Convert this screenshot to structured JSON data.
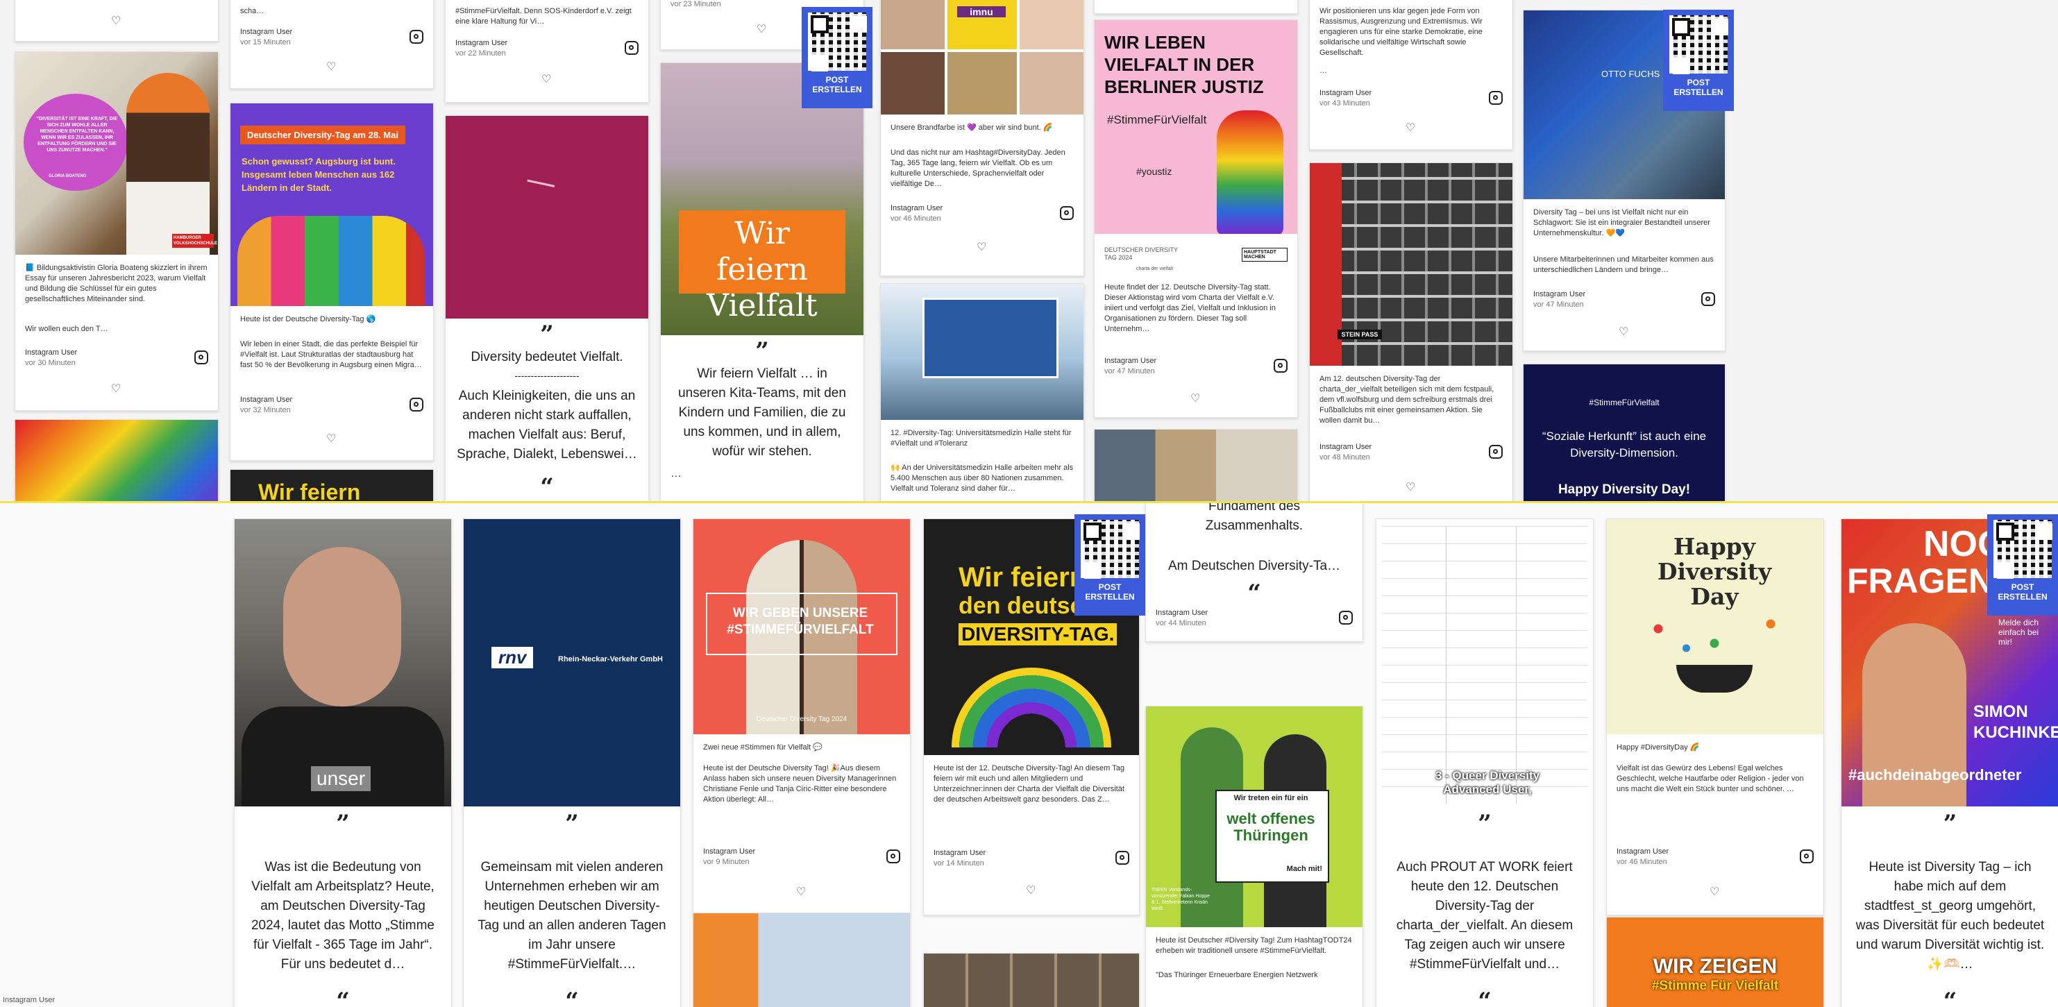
{
  "post_button": {
    "line1": "POST",
    "line2": "ERSTELLEN"
  },
  "quote_mark": "”",
  "quote_open": "“",
  "heart_glyph": "♡",
  "top": {
    "c1": {
      "gloria_quote": "\"DIVERSITÄT IST EINE KRAFT, DIE SICH ZUM WOHLE ALLER MENSCHEN ENTFALTEN KANN, WENN WIR ES ZULASSEN, IHR ENTFALTUNG FÖRDERN UND SIE UNS ZUNUTZE MACHEN.\"",
      "gloria_name": "GLORIA BOATENG",
      "gloria_badge": "HAMBURGER VOLKSHOCHSCHULE",
      "gloria_text": "📘 Bildungsaktivistin Gloria Boateng skizziert in ihrem Essay für unseren Jahresbericht 2023, warum Vielfalt und Bildung die Schlüssel für ein gutes gesellschaftliches Miteinander sind.",
      "gloria_text2": "Wir wollen euch den T…",
      "user": "Instagram User",
      "time": "vor 30 Minuten"
    },
    "c2": {
      "snippet": "scha…",
      "user": "Instagram User",
      "time1": "vor 15 Minuten",
      "banner": "Deutscher Diversity-Tag am 28. Mai",
      "headline": "Schon gewusst? Augsburg ist bunt. Insgesamt leben Menschen aus 162 Ländern in der Stadt.",
      "text1": "Heute ist der Deutsche Diversity-Tag 🌎",
      "text2": "Wir leben in einer Stadt, die das perfekte Beispiel für #Vielfalt ist. Laut Strukturatlas der stadtausburg hat fast 50 % der Bevölkerung in Augsburg einen Migra…",
      "time2": "vor 32 Minuten",
      "bottom_title": "Wir feiern"
    },
    "c3": {
      "snippet": "#StimmeFürVielfalt. Denn SOS-Kinderdorf e.V. zeigt eine klare Haltung für Vi…",
      "user": "Instagram User",
      "time": "vor 22 Minuten",
      "quote_head": "Diversity bedeutet Vielfalt.",
      "quote_rule": "--------------------",
      "quote_body": "Auch Kleinigkeiten, die uns an anderen nicht stark auffallen, machen Vielfalt aus: Beruf, Sprache, Dialekt, Lebenswei…"
    },
    "c4": {
      "snippet": "vor 23 Minuten",
      "overlay": "Wir feiern Vielfalt",
      "quote_body": "Wir feiern Vielfalt … in unseren Kita-Teams, mit den Kindern und Familien, die zu uns kommen, und in allem, wofür wir stehen.",
      "ellipsis": "…"
    },
    "c5": {
      "logo": "imnu",
      "text1": "Unsere Brandfarbe ist 💜 aber wir sind bunt. 🌈",
      "text2": "Und das nicht nur am Hashtag#DiversityDay. Jeden Tag, 365 Tage lang, feiern wir Vielfalt. Ob es um kulturelle Unterschiede, Sprachenvielfalt oder vielfältige De…",
      "user": "Instagram User",
      "time": "vor 46 Minuten",
      "text3": "12. #Diversity-Tag: Universitätsmedizin Halle steht für #Vielfalt und #Toleranz",
      "text4": "🙌 An der Universitätsmedizin Halle arbeiten mehr als 5.400 Menschen aus über 80 Nationen zusammen. Vielfalt und Toleranz sind daher für…"
    },
    "c6": {
      "headline": "WIR LEBEN VIELFALT IN DER BERLINER JUSTIZ",
      "hashtag": "#StimmeFürVielfalt",
      "youstiz": "#youstiz",
      "dt_logo": "DEUTSCHER DIVERSITY TAG 2024",
      "charta": "charta der vielfalt",
      "berlin": "HAUPTSTADT MACHEN",
      "text": "Heute findet der 12. Deutsche Diversity-Tag statt. Dieser Aktionstag wird vom Charta der Vielfalt e.V. iniiert und verfolgt das Ziel, Vielfalt und Inklusion in Organisationen zu fördern. Dieser Tag soll Unternehm…",
      "user": "Instagram User",
      "time": "vor 47 Minuten"
    },
    "c7": {
      "snippet": "Wir positionieren uns klar gegen jede Form von Rassismus, Ausgrenzung und Extremismus. Wir engagieren uns für eine starke Demokratie, eine solidarische und vielfältige Wirtschaft sowie Gesellschaft.",
      "snippet_more": "…",
      "user": "Instagram User",
      "time1": "vor 43 Minuten",
      "stickers": "STEIN PASS",
      "text": "Am 12. deutschen Diversity-Tag der charta_der_vielfalt beteiligen sich mit dem fcstpauli, dem vfl.wolfsburg und dem scfreiburg erstmals drei Fußballclubs mit einer gemeinsamen Aktion. Sie wollen damit bu…",
      "time2": "vor 48 Minuten"
    },
    "c8": {
      "logo": "OTTO FUCHS",
      "text1": "Diversity Tag – bei uns ist Vielfalt nicht nur ein Schlagwort: Sie ist ein integraler Bestandteil unserer Unternehmenskultur. 🧡💙",
      "text2": "Unsere Mitarbeiterinnen und Mitarbeiter kommen aus unterschiedlichen Ländern und bringe…",
      "user": "Instagram User",
      "time": "vor 47 Minuten",
      "hashtag": "#StimmeFürVielfalt",
      "quote": "“Soziale Herkunft” ist auch eine Diversity-Dimension.",
      "footer": "Happy Diversity Day!"
    }
  },
  "bottom": {
    "b1": {
      "caption": "unser",
      "quote_body": "Was ist die Bedeutung von Vielfalt am Arbeitsplatz? Heute, am Deutschen Diversity-Tag 2024, lautet das Motto „Stimme für Vielfalt - 365 Tage im Jahr“. Für uns bedeutet d…",
      "footer": "Instagram User"
    },
    "b2": {
      "logo": "rnv",
      "logo_sub": "Rhein-Neckar-Verkehr GmbH",
      "quote_body": "Gemeinsam mit vielen anderen Unternehmen erheben wir am heutigen Deutschen Diversity-Tag und an allen anderen Tagen im Jahr unsere #StimmeFürVielfalt.…"
    },
    "b3": {
      "overlay": "WIR GEBEN UNSERE #STIMMEFÜRVIELFALT",
      "caption": "Deutscher Diversity Tag 2024",
      "text1": "Zwei neue #Stimmen für Vielfalt 💬",
      "text2": "Heute ist der Deutsche Diversity Tag! 🎉Aus diesem Anlass haben sich unsere neuen Diversity Managerinnen Christiane Fenle und Tanja Ciric-Ritter eine besondere Aktion überlegt: All…",
      "user": "Instagram User",
      "time": "vor 9 Minuten"
    },
    "b4": {
      "headline1": "Wir feiern",
      "headline2": "den deutschen",
      "headline3": "DIVERSITY-TAG.",
      "text": "Heute ist der 12. Deutsche Diversity-Tag! An diesem Tag feiern wir mit euch und allen Mitgliedern und Unterzeichner:innen der Charta der Vielfalt die Diversität der deutschen Arbeitswelt ganz besonders. Das Z…",
      "user": "Instagram User",
      "time": "vor 14 Minuten"
    },
    "b5": {
      "top1": "Fundament des",
      "top2": "Zusammenhalts.",
      "top3": "Am Deutschen Diversity-Ta…",
      "user": "Instagram User",
      "time": "vor 44 Minuten",
      "sign1": "Wir treten ein für ein",
      "sign2": "welt offenes Thüringen",
      "sign3": "Mach mit!",
      "people": "ThEEN Vorstands-vorsitzender Fabian Hoppe & 1. Stellvertreterin Kristin Weiß",
      "text1": "Heute ist Deutscher #Diversity Tag! Zum HashtagTODT24 erheben wir traditionell unsere #StimmeFürVielfalt.",
      "text2": "\"Das Thüringer Erneuerbare Energien Netzwerk"
    },
    "b6": {
      "overlay": "3 - Queer Diversity Advanced User,",
      "quote_body": "Auch PROUT AT WORK feiert heute den 12. Deutschen Diversity-Tag der charta_der_vielfalt. An diesem Tag zeigen auch wir unsere #StimmeFürVielfalt und…"
    },
    "b7": {
      "title": "Happy Diversity Day",
      "text1": "Happy #DiversityDay 🌈",
      "text2": "Vielfalt ist das Gewürz des Lebens! Egal welches Geschlecht, welche Hautfarbe oder Religion - jeder von uns macht die Welt ein Stück bunter und schöner. …",
      "user": "Instagram User",
      "time": "vor 46 Minuten",
      "bottom1": "WIR ZEIGEN",
      "bottom2": "#Stimme Für Vielfalt"
    },
    "b8": {
      "head1": "NOCH",
      "head2": "FRAGEN?",
      "small": "Melde dich einfach bei mir!",
      "name1": "SIMON",
      "name2": "KUCHINKE",
      "hashtag": "#auchdeinabgeordneter",
      "quote_body": "Heute ist Diversity Tag – ich habe mich auf dem stadtfest_st_georg umgehört, was Diversität für euch bedeutet und warum Diversität wichtig ist. ✨🫶🏻…"
    }
  },
  "bottom_left_label": "Instagram User"
}
